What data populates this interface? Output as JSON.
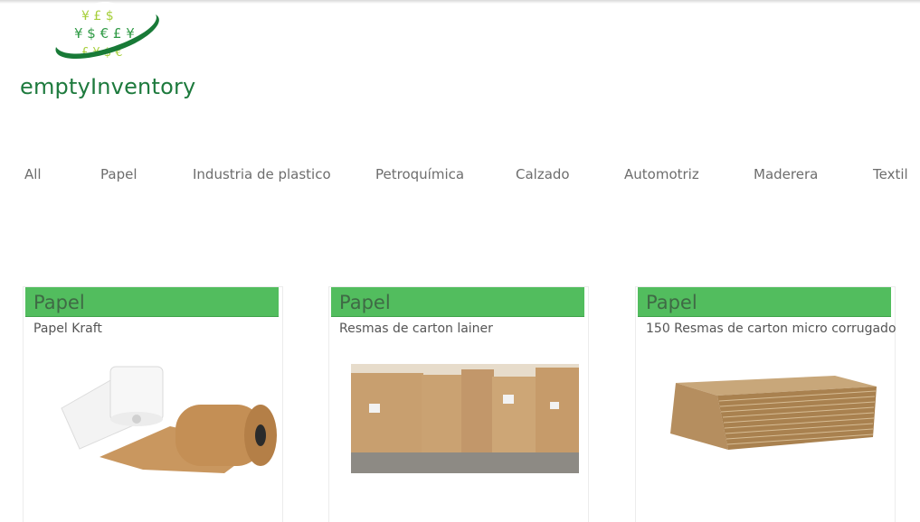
{
  "header": {
    "logo_text": "emptyInventory",
    "logo_symbols": "¥£$€£¥"
  },
  "nav": {
    "items": [
      {
        "label": "All"
      },
      {
        "label": "Papel"
      },
      {
        "label": "Industria de plastico"
      },
      {
        "label": "Petroquímica"
      },
      {
        "label": "Calzado"
      },
      {
        "label": "Automotriz"
      },
      {
        "label": "Maderera"
      },
      {
        "label": "Textil"
      }
    ]
  },
  "products": [
    {
      "category": "Papel",
      "title": "Papel Kraft",
      "image": "paper-rolls"
    },
    {
      "category": "Papel",
      "title": "Resmas de carton lainer",
      "image": "cardboard-rolls-warehouse"
    },
    {
      "category": "Papel",
      "title": "150 Resmas de carton micro corrugado",
      "image": "corrugated-sheet-stack"
    }
  ],
  "colors": {
    "brand_green": "#1d7a3d",
    "category_bar": "#52bd5e",
    "nav_text": "#6d6d6d"
  }
}
